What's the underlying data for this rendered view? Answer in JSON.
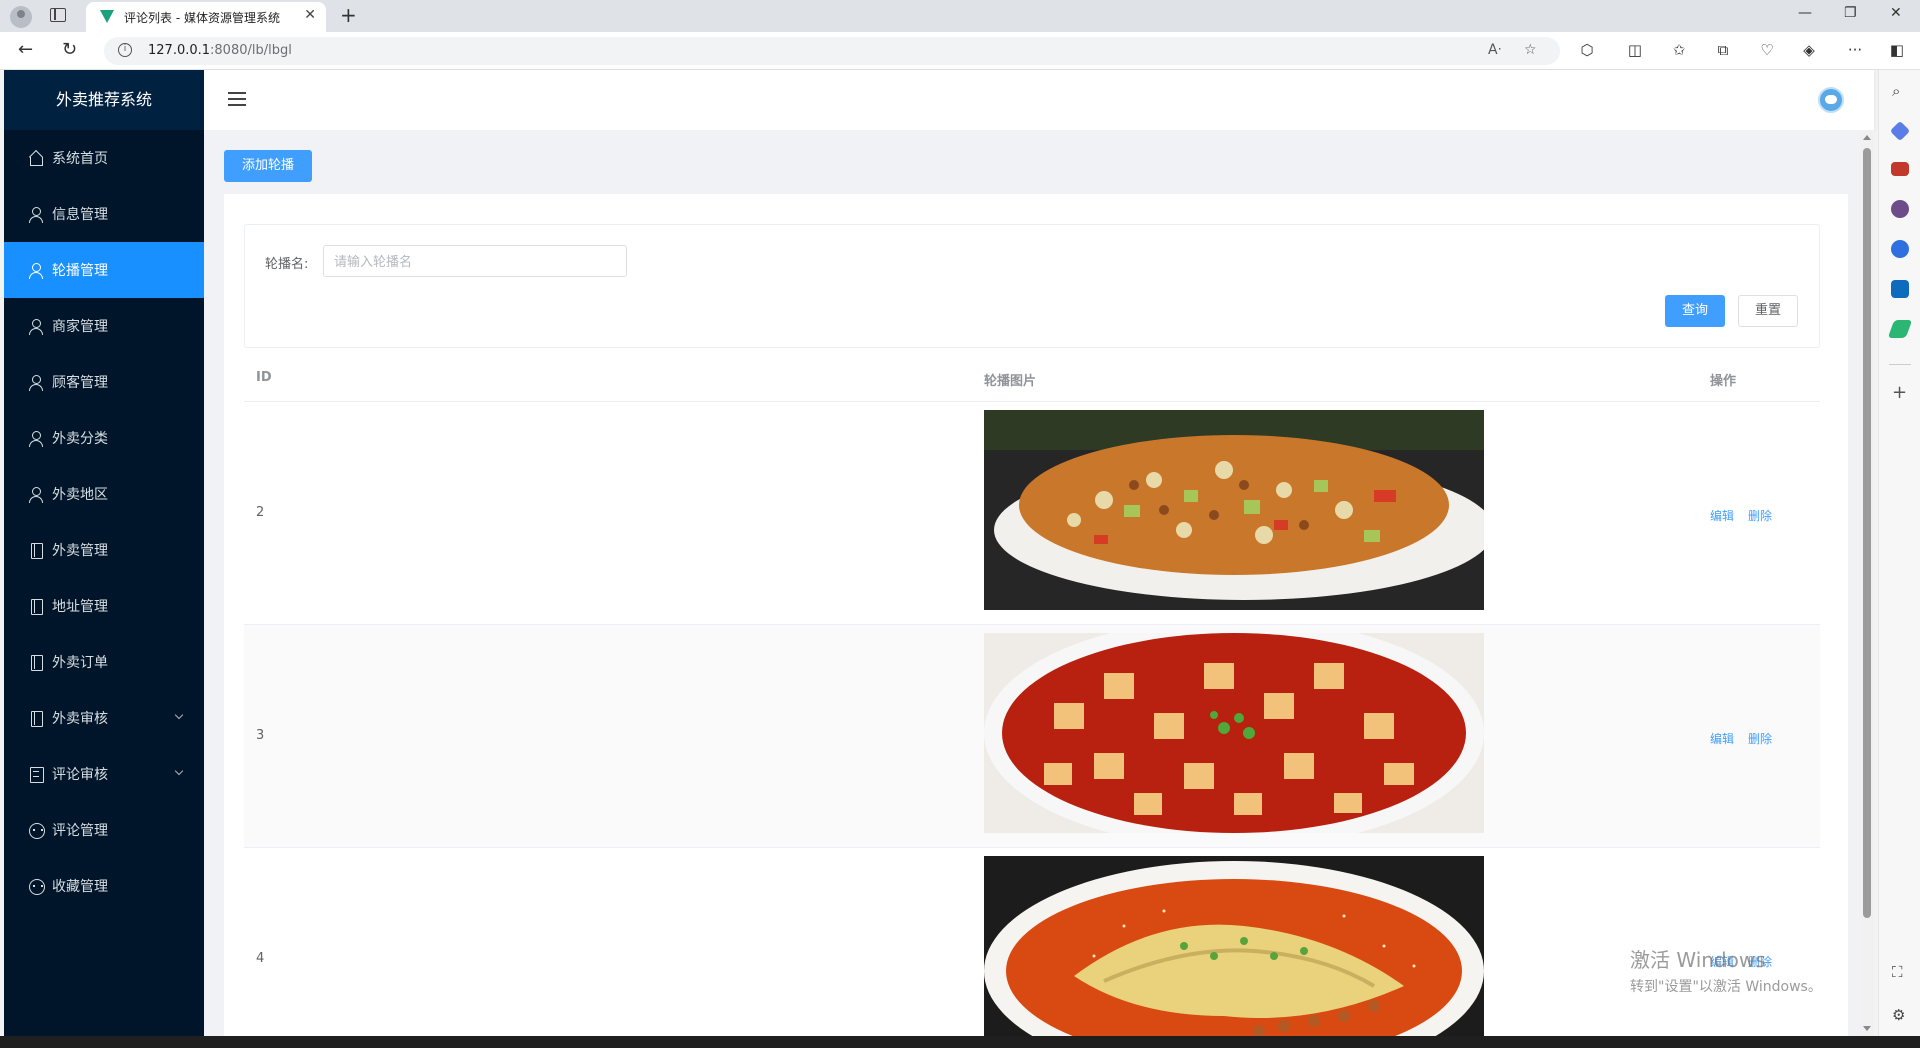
{
  "browser": {
    "tab_title": "评论列表 - 媒体资源管理系统",
    "url_host": "127.0.0.1",
    "url_rest": ":8080/lb/lbgl"
  },
  "sidebar": {
    "brand": "外卖推荐系统",
    "items": [
      {
        "label": "系统首页",
        "icon": "home-icon"
      },
      {
        "label": "信息管理",
        "icon": "user-icon"
      },
      {
        "label": "轮播管理",
        "icon": "user-icon",
        "active": true
      },
      {
        "label": "商家管理",
        "icon": "user-icon"
      },
      {
        "label": "顾客管理",
        "icon": "user-icon"
      },
      {
        "label": "外卖分类",
        "icon": "user-icon"
      },
      {
        "label": "外卖地区",
        "icon": "user-icon"
      },
      {
        "label": "外卖管理",
        "icon": "document-icon"
      },
      {
        "label": "地址管理",
        "icon": "document-icon"
      },
      {
        "label": "外卖订单",
        "icon": "document-icon"
      },
      {
        "label": "外卖审核",
        "icon": "document-icon",
        "submenu": true
      },
      {
        "label": "评论审核",
        "icon": "list-icon",
        "submenu": true
      },
      {
        "label": "评论管理",
        "icon": "chat-icon"
      },
      {
        "label": "收藏管理",
        "icon": "chat-icon"
      }
    ]
  },
  "toolbar": {
    "add_label": "添加轮播"
  },
  "search": {
    "label": "轮播名:",
    "placeholder": "请输入轮播名",
    "query_label": "查询",
    "reset_label": "重置"
  },
  "table": {
    "columns": [
      "ID",
      "轮播图片",
      "操作"
    ],
    "rows": [
      {
        "id": "2",
        "image": "kung-pao-chicken-photo"
      },
      {
        "id": "3",
        "image": "mapo-tofu-photo"
      },
      {
        "id": "4",
        "image": "sliced-chicken-chili-oil-photo"
      }
    ],
    "edit_label": "编辑",
    "delete_label": "删除"
  },
  "watermark": {
    "line1": "激活 Windows",
    "line2": "转到\"设置\"以激活 Windows。"
  },
  "colors": {
    "sidebar_bg": "#001529",
    "active_item": "#1890ff",
    "primary": "#409eff"
  }
}
